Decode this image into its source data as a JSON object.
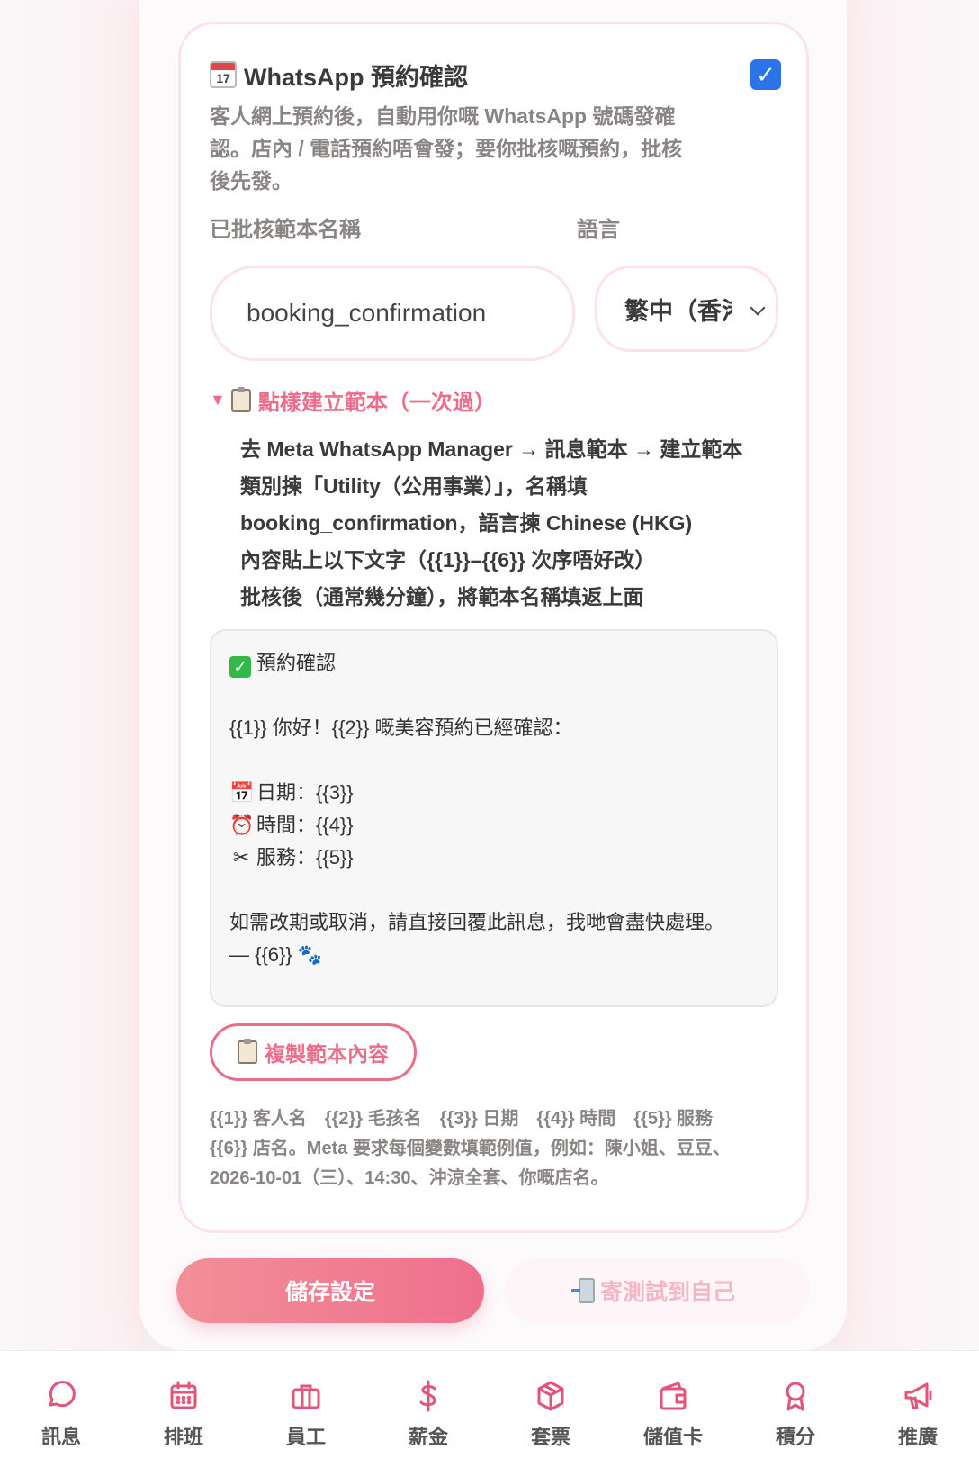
{
  "card": {
    "title": "WhatsApp 預約確認",
    "calendar_day": "17",
    "enabled": true,
    "description_lines": [
      "客人網上預約後，自動用你嘅 WhatsApp 號碼發確",
      "認。店內 / 電話預約唔會發；要你批核嘅預約，批核",
      "後先發。"
    ]
  },
  "form": {
    "template_name_label": "已批核範本名稱",
    "template_name_value": "booking_confirmation",
    "language_label": "語言",
    "language_value": "繁中（香港）"
  },
  "guide": {
    "summary": "點樣建立範本（一次過）",
    "steps": [
      "去 Meta WhatsApp Manager → 訊息範本 → 建立範本",
      "類別揀「Utility（公用事業）」，名稱填",
      "booking_confirmation，語言揀 Chinese (HKG)",
      "內容貼上以下文字（{{1}}–{{6}} 次序唔好改）",
      "批核後（通常幾分鐘），將範本名稱填返上面"
    ]
  },
  "template": {
    "heading": "預約確認",
    "greeting": "{{1}} 你好！{{2}} 嘅美容預約已經確認：",
    "date_line": "日期：{{3}}",
    "time_line": "時間：{{4}}",
    "service_line": "服務：{{5}}",
    "closing": "如需改期或取消，請直接回覆此訊息，我哋會盡快處理。",
    "signature": "— {{6}} 🐾"
  },
  "copy_button": "複製範本內容",
  "variables_note": "{{1}} 客人名　{{2}} 毛孩名　{{3}} 日期　{{4}} 時間　{{5}} 服務　{{6}} 店名。Meta 要求每個變數填範例值，例如：陳小姐、豆豆、2026-10-01（三）、14:30、沖涼全套、你嘅店名。",
  "actions": {
    "save": "儲存設定",
    "test": "寄測試到自己"
  },
  "nav": [
    {
      "label": "訊息",
      "icon": "chat-icon"
    },
    {
      "label": "排班",
      "icon": "calendar-icon"
    },
    {
      "label": "員工",
      "icon": "briefcase-icon"
    },
    {
      "label": "薪金",
      "icon": "dollar-icon"
    },
    {
      "label": "套票",
      "icon": "package-icon"
    },
    {
      "label": "儲值卡",
      "icon": "wallet-icon"
    },
    {
      "label": "積分",
      "icon": "award-icon"
    },
    {
      "label": "推廣",
      "icon": "megaphone-icon"
    }
  ],
  "colors": {
    "accent": "#ec6d8a",
    "checkbox": "#2a74e8",
    "nav_icon": "#e2547a"
  }
}
